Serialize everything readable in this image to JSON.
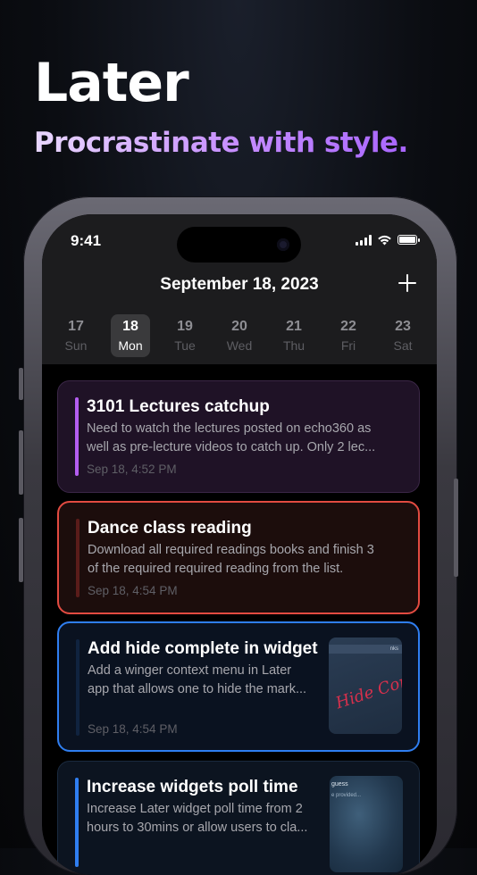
{
  "app": {
    "name": "Later",
    "tagline": "Procrastinate with style."
  },
  "status_bar": {
    "time": "9:41"
  },
  "header": {
    "date": "September 18, 2023",
    "add_label": "+"
  },
  "week": [
    {
      "num": "17",
      "day": "Sun",
      "selected": false
    },
    {
      "num": "18",
      "day": "Mon",
      "selected": true
    },
    {
      "num": "19",
      "day": "Tue",
      "selected": false
    },
    {
      "num": "20",
      "day": "Wed",
      "selected": false
    },
    {
      "num": "21",
      "day": "Thu",
      "selected": false
    },
    {
      "num": "22",
      "day": "Fri",
      "selected": false
    },
    {
      "num": "23",
      "day": "Sat",
      "selected": false
    }
  ],
  "tasks": [
    {
      "title": "3101 Lectures catchup",
      "desc1": "Need to watch the lectures posted on echo360 as",
      "desc2": "well as pre-lecture videos to catch up. Only 2 lec...",
      "time": "Sep 18, 4:52 PM",
      "accent": "#b45df0",
      "bg": "#1f1226",
      "border": "#3b2747"
    },
    {
      "title": "Dance class reading",
      "desc1": "Download all required readings books and finish 3",
      "desc2": "of the required required reading from the list.",
      "time": "Sep 18, 4:54 PM",
      "accent": "#5a1c1a",
      "bg": "#1c0d0c",
      "border": "#e24b41"
    },
    {
      "title": "Add hide complete in widget",
      "desc1": "Add a winger context menu in Later",
      "desc2": "app that allows one to hide the mark...",
      "time": "Sep 18, 4:54 PM",
      "accent": "#10233f",
      "bg": "#0a1220",
      "border": "#2f7ef0",
      "thumb_text": "nks",
      "thumb_script": "Hide Comp"
    },
    {
      "title": "Increase widgets poll time",
      "desc1": "Increase Later widget poll time from 2",
      "desc2": "hours to 30mins or allow users to cla...",
      "accent": "#2f7ef0",
      "bg": "#0c1420",
      "border": "#1a2a3e",
      "thumb_text1": "guess",
      "thumb_text2": "e provided..."
    }
  ]
}
